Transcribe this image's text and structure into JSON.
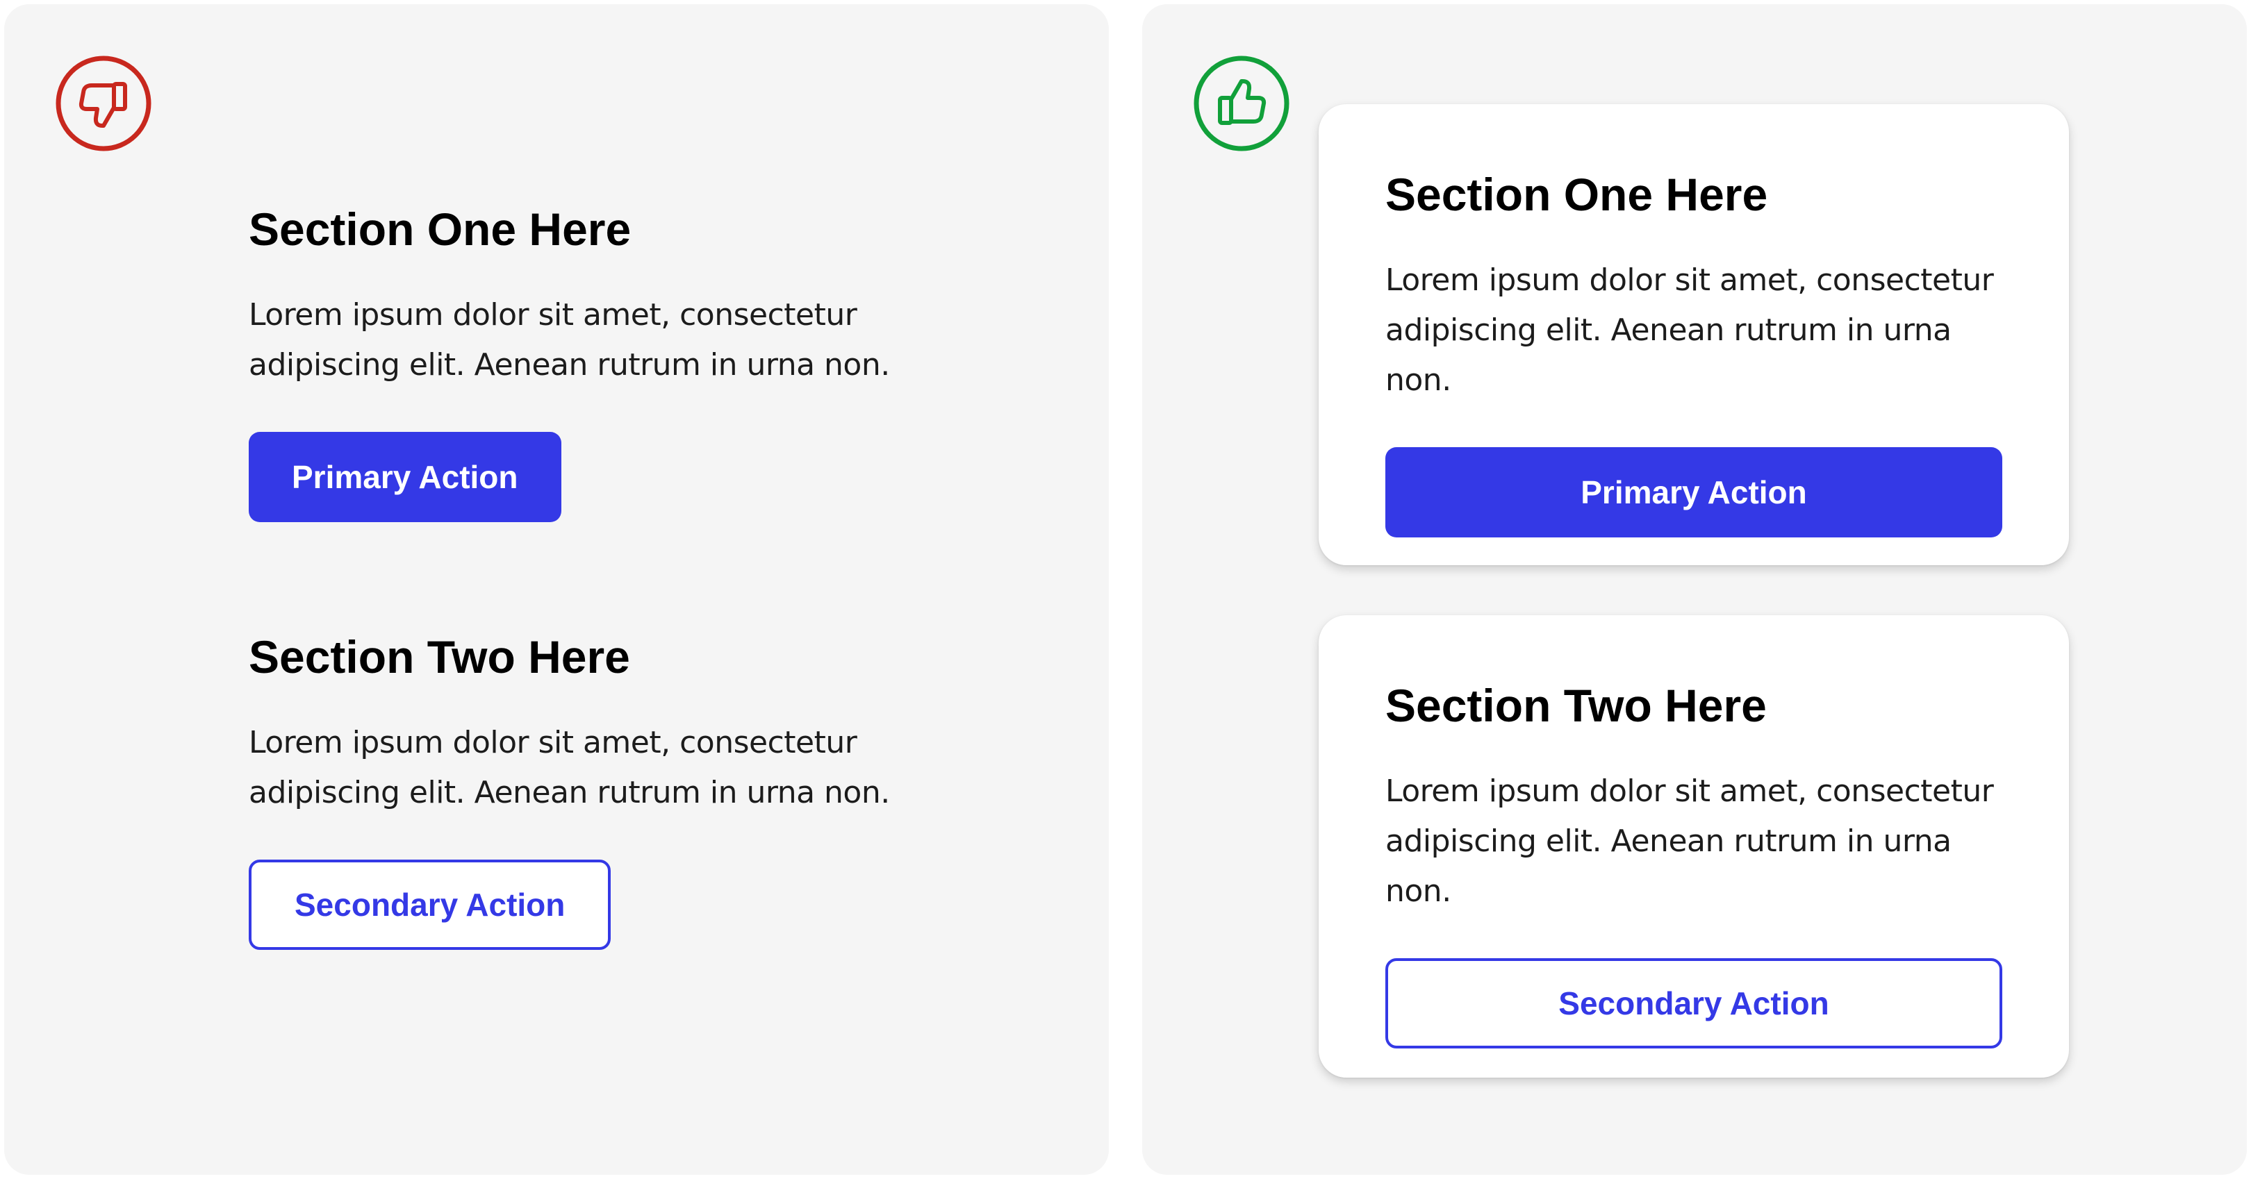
{
  "comparison": {
    "bad": {
      "verdict_icon": "thumbs-down-icon",
      "verdict_color": "#c8281e",
      "sections": [
        {
          "title": "Section One Here",
          "body": "Lorem ipsum dolor sit amet, consectetur adipiscing elit. Aenean rutrum in urna non.",
          "button_label": "Primary Action",
          "button_style": "primary"
        },
        {
          "title": "Section Two Here",
          "body": "Lorem ipsum dolor sit amet, consectetur adipiscing elit. Aenean rutrum in urna non.",
          "button_label": "Secondary Action",
          "button_style": "secondary"
        }
      ]
    },
    "good": {
      "verdict_icon": "thumbs-up-icon",
      "verdict_color": "#11a03a",
      "cards": [
        {
          "title": "Section One Here",
          "body": "Lorem ipsum dolor sit amet, consectetur adipiscing elit. Aenean rutrum in urna non.",
          "button_label": "Primary Action",
          "button_style": "primary"
        },
        {
          "title": "Section Two Here",
          "body": "Lorem ipsum dolor sit amet, consectetur adipiscing elit. Aenean rutrum in urna non.",
          "button_label": "Secondary Action",
          "button_style": "secondary"
        }
      ]
    }
  },
  "colors": {
    "accent": "#3439e6",
    "panel_background": "#f5f5f5",
    "card_background": "#ffffff",
    "text": "#000000"
  }
}
